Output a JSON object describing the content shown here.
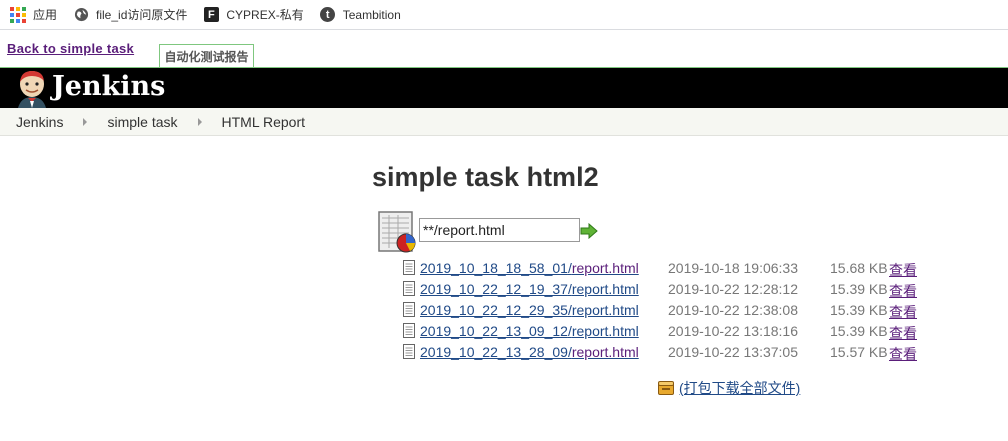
{
  "bookmarks": [
    {
      "label": "应用",
      "icon": "apps-grid-icon"
    },
    {
      "label": "file_id访问原文件",
      "icon": "globe-icon"
    },
    {
      "label": "CYPREX-私有",
      "icon": "f-logo-icon",
      "glyph": "F"
    },
    {
      "label": "Teambition",
      "icon": "t-logo-icon",
      "glyph": "t"
    }
  ],
  "nav": {
    "back_label": "Back to simple task",
    "report_tab_label": "自动化测试报告"
  },
  "header": {
    "logo_text": "Jenkins"
  },
  "breadcrumb": [
    "Jenkins",
    "simple task",
    "HTML Report"
  ],
  "main": {
    "title": "simple task html2",
    "filter_value": "**/report.html",
    "files": [
      {
        "dir": "2019_10_18_18_58_01",
        "file": "report.html",
        "date": "2019-10-18 19:06:33",
        "size": "15.68 KB",
        "view": "查看"
      },
      {
        "dir": "2019_10_22_12_19_37",
        "file": "report.html",
        "date": "2019-10-22 12:28:12",
        "size": "15.39 KB",
        "view": "查看"
      },
      {
        "dir": "2019_10_22_12_29_35",
        "file": "report.html",
        "date": "2019-10-22 12:38:08",
        "size": "15.39 KB",
        "view": "查看"
      },
      {
        "dir": "2019_10_22_13_09_12",
        "file": "report.html",
        "date": "2019-10-22 13:18:16",
        "size": "15.39 KB",
        "view": "查看"
      },
      {
        "dir": "2019_10_22_13_28_09",
        "file": "report.html",
        "date": "2019-10-22 13:37:05",
        "size": "15.57 KB",
        "view": "查看"
      }
    ],
    "zip_label": "(打包下载全部文件)"
  },
  "colors": {
    "link": "#204a87",
    "visited": "#5a1e7a",
    "header_bg": "#000000",
    "tab_border": "#7fc77f"
  }
}
